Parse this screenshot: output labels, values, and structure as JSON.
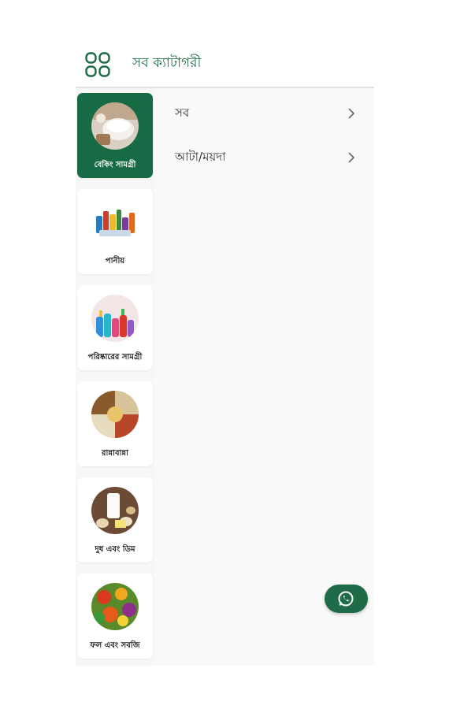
{
  "header": {
    "title": "সব ক্যাটাগরী"
  },
  "categories": [
    {
      "label": "বেকিং সামগ্রী",
      "active": true,
      "icon": "flour-baking-image"
    },
    {
      "label": "পানীয়",
      "active": false,
      "icon": "beverages-image"
    },
    {
      "label": "পরিষ্কারের সামগ্রী",
      "active": false,
      "icon": "cleaning-products-image"
    },
    {
      "label": "রান্নাবান্না",
      "active": false,
      "icon": "grains-spices-image"
    },
    {
      "label": "দুধ এবং ডিম",
      "active": false,
      "icon": "milk-eggs-image"
    },
    {
      "label": "ফল এবং সবজি",
      "active": false,
      "icon": "fruits-vegetables-image"
    }
  ],
  "subcategories": [
    {
      "label": "সব"
    },
    {
      "label": "আটা/ময়দা"
    }
  ],
  "colors": {
    "primary": "#166b45",
    "background": "#f7f7f7"
  },
  "fab": {
    "icon": "whatsapp-icon"
  }
}
